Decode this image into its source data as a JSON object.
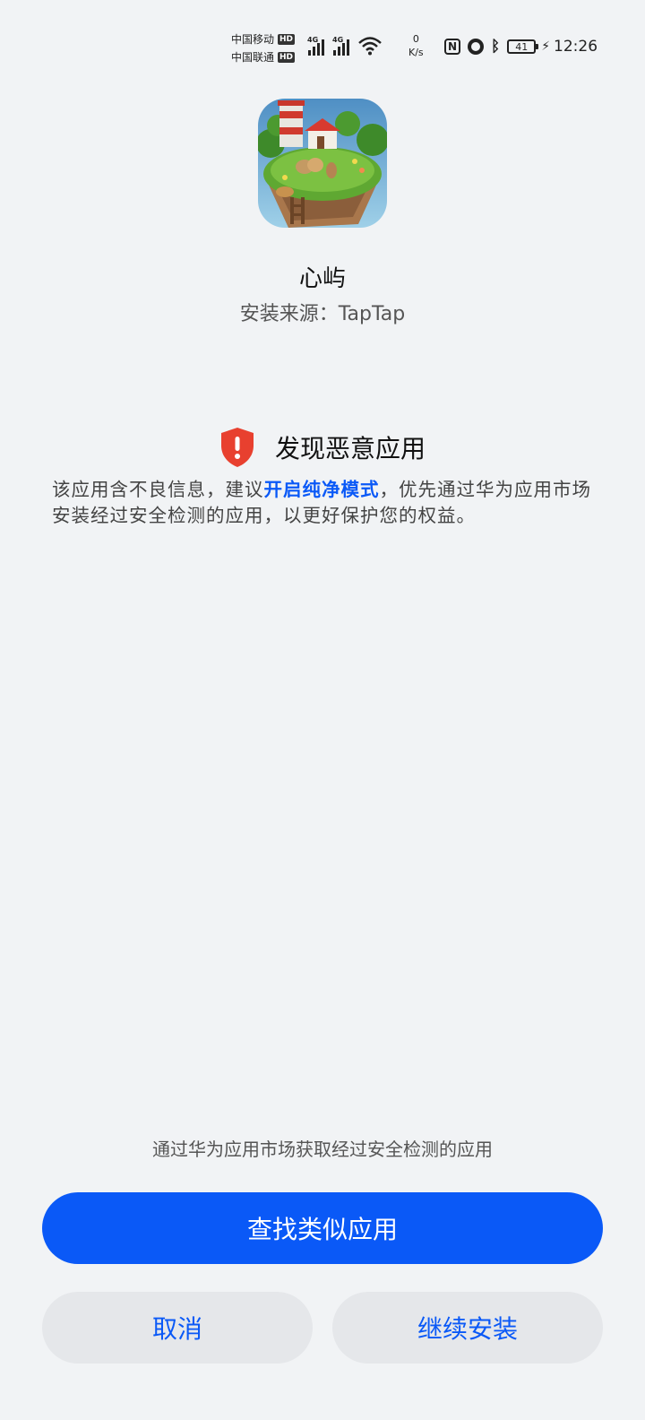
{
  "status_bar": {
    "carrier1": "中国移动",
    "carrier2": "中国联通",
    "hd": "HD",
    "network1": "4G",
    "network2": "4G",
    "speed_value": "0",
    "speed_unit": "K/s",
    "nfc": "N",
    "battery": "41",
    "time": "12:26"
  },
  "app": {
    "name": "心屿",
    "install_source": "安装来源：TapTap"
  },
  "warning": {
    "title": "发现恶意应用",
    "text_before": "该应用含不良信息，建议",
    "link": "开启纯净模式",
    "text_after": "，优先通过华为应用市场安装经过安全检测的应用，以更好保护您的权益。"
  },
  "bottom": {
    "hint": "通过华为应用市场获取经过安全检测的应用",
    "primary_button": "查找类似应用",
    "cancel_button": "取消",
    "continue_button": "继续安装"
  },
  "colors": {
    "accent": "#0a59f7",
    "warning": "#e8402f",
    "background": "#f1f3f5"
  }
}
